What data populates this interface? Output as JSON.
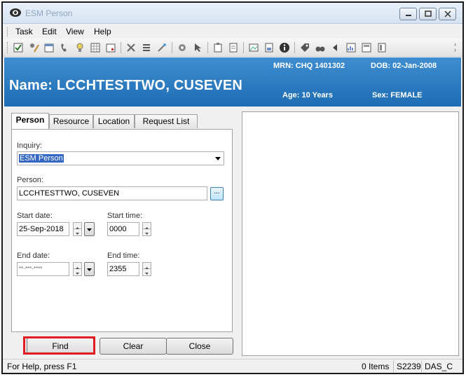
{
  "window": {
    "title": "ESM Person"
  },
  "menu": [
    {
      "label": "Task"
    },
    {
      "label": "Edit"
    },
    {
      "label": "View"
    },
    {
      "label": "Help"
    }
  ],
  "banner": {
    "name": "Name: LCCHTESTTWO, CUSEVEN",
    "mrn": "MRN: CHQ 1401302",
    "dob": "DOB: 02-Jan-2008",
    "age": "Age: 10 Years",
    "sex": "Sex: FEMALE",
    "color": "#2a7cc4"
  },
  "tabs": [
    {
      "label": "Person",
      "active": true
    },
    {
      "label": "Resource"
    },
    {
      "label": "Location"
    },
    {
      "label": "Request List"
    }
  ],
  "form": {
    "inquiry_label": "Inquiry:",
    "inquiry_value": "ESM Person",
    "person_label": "Person:",
    "person_value": "LCCHTESTTWO, CUSEVEN",
    "ellipsis_label": "...",
    "start_date_label": "Start date:",
    "start_date_value": "25-Sep-2018",
    "start_time_label": "Start time:",
    "start_time_value": "0000",
    "end_date_label": "End date:",
    "end_date_value": "**-***-****",
    "end_time_label": "End time:",
    "end_time_value": "2355"
  },
  "buttons": {
    "find": "Find",
    "clear": "Clear",
    "close": "Close"
  },
  "statusbar": {
    "help": "For Help, press F1",
    "items": "0 Items",
    "code": "S2239",
    "user": "DAS_C"
  },
  "colors": {
    "highlight": "#e01b22",
    "selection": "#3367c2"
  }
}
